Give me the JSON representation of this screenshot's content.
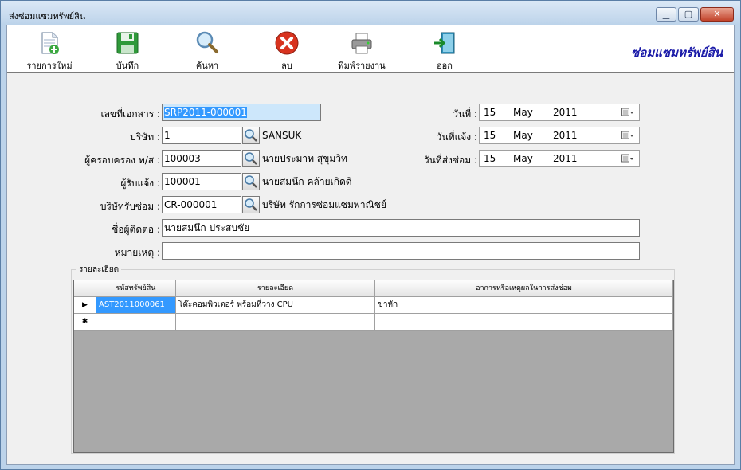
{
  "window": {
    "title": "ส่งซ่อมแซมทรัพย์สิน",
    "brand": "ซ่อมแซมทรัพย์สิน"
  },
  "toolbar": {
    "new_label": "รายการใหม่",
    "save_label": "บันทึก",
    "search_label": "ค้นหา",
    "delete_label": "ลบ",
    "print_label": "พิมพ์รายงาน",
    "exit_label": "ออก"
  },
  "icons": {
    "new": "new-document-icon",
    "save": "floppy-disk-icon",
    "search": "magnifier-icon",
    "delete": "red-x-icon",
    "print": "printer-icon",
    "exit": "exit-door-icon",
    "lookup": "magnifier-icon",
    "calendar": "calendar-dropdown-icon"
  },
  "colors": {
    "accent_blue": "#1a1aa8",
    "selection": "#3399ff",
    "save_green": "#2f9a3a",
    "delete_red": "#d8331f"
  },
  "form": {
    "doc_no_label": "เลขที่เอกสาร :",
    "doc_no_value": "SRP2011-000001",
    "company_label": "บริษัท :",
    "company_value": "1",
    "company_name": "SANSUK",
    "custodian_label": "ผู้ครอบครอง ท/ส :",
    "custodian_value": "100003",
    "custodian_name": "นายประมาท  สุขุมวิท",
    "receiver_label": "ผู้รับแจ้ง :",
    "receiver_value": "100001",
    "receiver_name": "นายสมนึก  คล้ายเกิดดิ",
    "repair_company_label": "บริษัทรับซ่อม :",
    "repair_company_value": "CR-000001",
    "repair_company_name": "บริษัท รักการซ่อมแซมพาณิชย์",
    "contact_label": "ชื่อผู้ติดต่อ :",
    "contact_value": "นายสมนึก  ประสบชัย",
    "remark_label": "หมายเหตุ :",
    "remark_value": ""
  },
  "dates": [
    {
      "label": "วันที่ :",
      "day": "15",
      "month": "May",
      "year": "2011"
    },
    {
      "label": "วันที่แจ้ง :",
      "day": "15",
      "month": "May",
      "year": "2011"
    },
    {
      "label": "วันที่ส่งซ่อม :",
      "day": "15",
      "month": "May",
      "year": "2011"
    }
  ],
  "details": {
    "group_title": "รายละเอียด",
    "columns": [
      "รหัสทรัพย์สิน",
      "รายละเอียด",
      "อาการหรือเหตุผลในการส่งซ่อม"
    ],
    "rows": [
      {
        "marker": "▶",
        "code": "AST2011000061",
        "description": "โต๊ะคอมพิวเตอร์ พร้อมที่วาง CPU",
        "reason": "ขาหัก"
      },
      {
        "marker": "✱",
        "code": "",
        "description": "",
        "reason": ""
      }
    ]
  }
}
